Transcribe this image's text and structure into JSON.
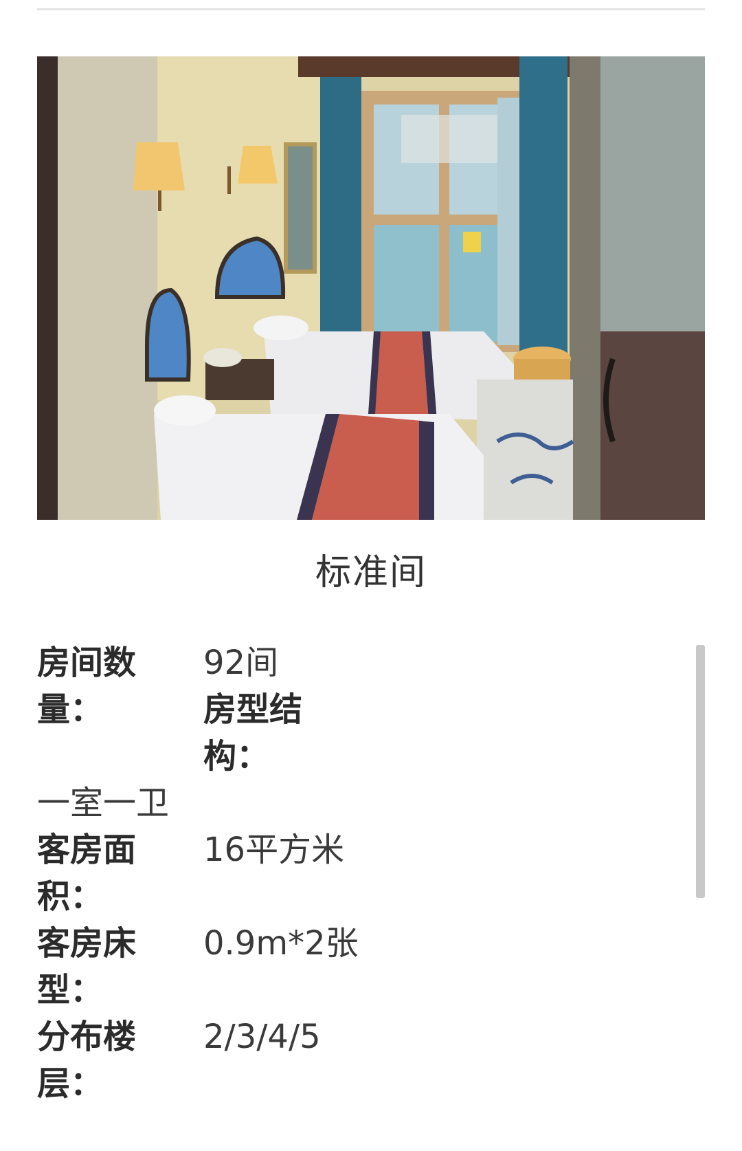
{
  "room": {
    "name": "标准间",
    "photo_icon": "hotel-room-photo"
  },
  "specs": {
    "room_count_label": "房间数量：",
    "room_count_value": "92间",
    "layout_label": "房型结构：",
    "layout_value": "一室一卫",
    "area_label": "客房面积：",
    "area_value": "16平方米",
    "bed_label": "客房床型：",
    "bed_value": "0.9m*2张",
    "floor_label": "分布楼层：",
    "floor_value": "2/3/4/5"
  },
  "colors": {
    "headboard": "#4f86c6",
    "curtain": "#2e6c86",
    "bed_runner": "#c95d4e",
    "scrollbar": "#c8c8c8"
  }
}
